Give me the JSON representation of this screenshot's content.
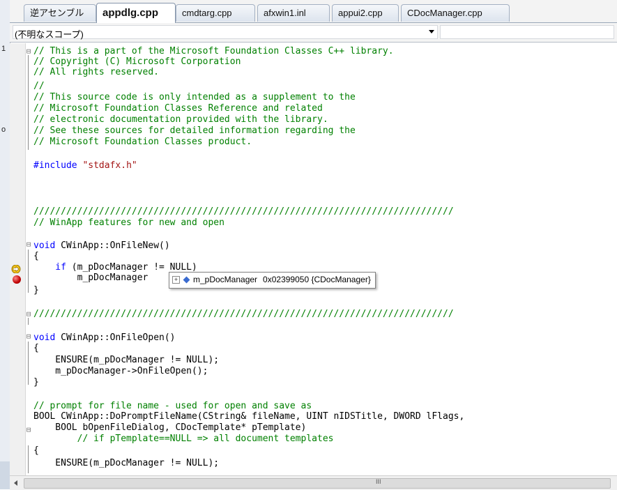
{
  "left_strip": [
    "1",
    "o"
  ],
  "tabs": [
    {
      "label": "逆アセンブル",
      "active": false
    },
    {
      "label": "appdlg.cpp",
      "active": true
    },
    {
      "label": "cmdtarg.cpp",
      "active": false
    },
    {
      "label": "afxwin1.inl",
      "active": false
    },
    {
      "label": "appui2.cpp",
      "active": false
    },
    {
      "label": "CDocManager.cpp",
      "active": false
    }
  ],
  "scope": {
    "value": "(不明なスコープ)"
  },
  "code": {
    "l01": "// This is a part of the Microsoft Foundation Classes C++ library.",
    "l02": "// Copyright (C) Microsoft Corporation",
    "l03": "// All rights reserved.",
    "l04": "//",
    "l05": "// This source code is only intended as a supplement to the",
    "l06": "// Microsoft Foundation Classes Reference and related",
    "l07": "// electronic documentation provided with the library.",
    "l08": "// See these sources for detailed information regarding the",
    "l09": "// Microsoft Foundation Classes product.",
    "l10_kw": "#include",
    "l10_str": "\"stdafx.h\"",
    "l11": "/////////////////////////////////////////////////////////////////////////////",
    "l12": "// WinApp features for new and open",
    "l13_kw": "void",
    "l13_rest": " CWinApp::OnFileNew()",
    "l14": "{",
    "l15_kw": "    if",
    "l15_rest": " (m_pDocManager != NULL)",
    "l16": "        m_pDocManager",
    "l17": "}",
    "l18": "/////////////////////////////////////////////////////////////////////////////",
    "l19_kw": "void",
    "l19_rest": " CWinApp::OnFileOpen()",
    "l20": "{",
    "l21": "    ENSURE(m_pDocManager != NULL);",
    "l22": "    m_pDocManager->OnFileOpen();",
    "l23": "}",
    "l24": "// prompt for file name - used for open and save as",
    "l25": "BOOL CWinApp::DoPromptFileName(CString& fileName, UINT nIDSTitle, DWORD lFlags,",
    "l26": "    BOOL bOpenFileDialog, CDocTemplate* pTemplate)",
    "l27": "        // if pTemplate==NULL => all document templates",
    "l28": "{",
    "l29": "    ENSURE(m_pDocManager != NULL);"
  },
  "tooltip": {
    "plus": "+",
    "name": "m_pDocManager",
    "value": "0x02399050 {CDocManager}"
  },
  "hscroll": {
    "grip": "III"
  },
  "colors": {
    "comment": "#008000",
    "keyword": "#0000ff",
    "string": "#a31515",
    "breakpoint": "#c00000"
  }
}
